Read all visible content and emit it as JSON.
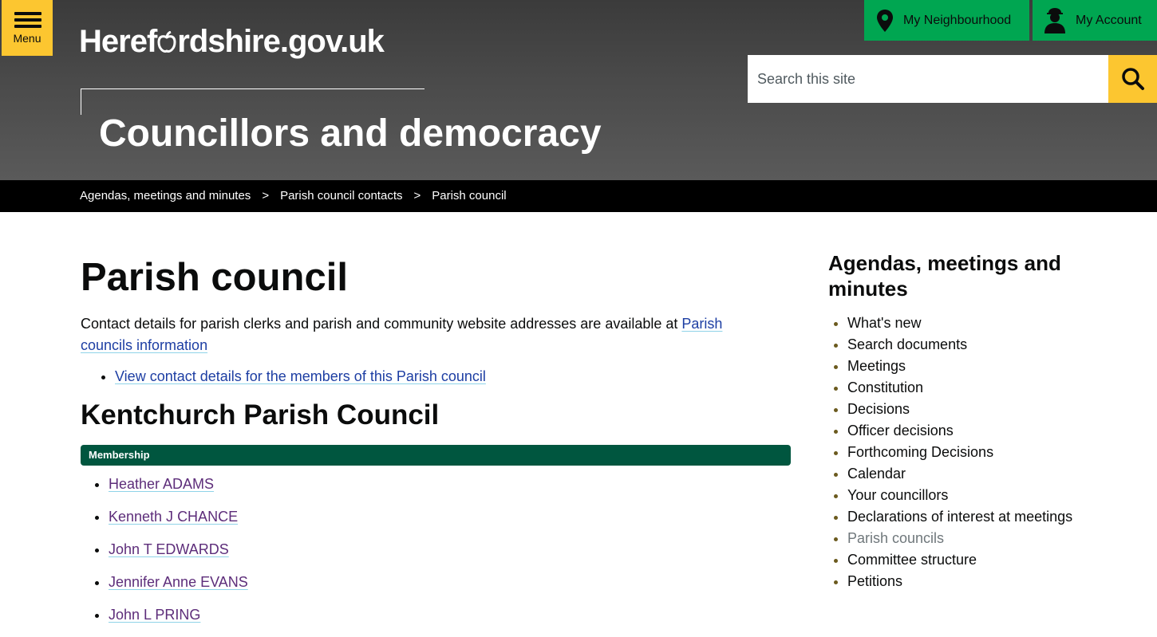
{
  "header": {
    "menu_label": "Menu",
    "logo_pre": "Heref",
    "logo_post": "rdshire.gov.uk",
    "section_title": "Councillors and democracy",
    "neighbourhood_label": "My Neighbourhood",
    "account_label": "My Account",
    "search_placeholder": "Search this site"
  },
  "breadcrumb": {
    "items": [
      "Agendas, meetings and minutes",
      "Parish council contacts",
      "Parish council"
    ],
    "separator": ">"
  },
  "main": {
    "title": "Parish council",
    "intro_text": "Contact details for parish clerks and parish and community website addresses are available at ",
    "intro_link": "Parish councils information",
    "members_link": "View contact details for the members of this Parish council",
    "council_name": "Kentchurch Parish Council",
    "membership_label": "Membership",
    "members": [
      "Heather ADAMS",
      "Kenneth J CHANCE",
      "John T EDWARDS",
      "Jennifer Anne EVANS",
      "John L PRING"
    ]
  },
  "sidebar": {
    "title": "Agendas, meetings and minutes",
    "items": [
      "What's new",
      "Search documents",
      "Meetings",
      "Constitution",
      "Decisions",
      "Officer decisions",
      "Forthcoming Decisions",
      "Calendar",
      "Your councillors",
      "Declarations of interest at meetings",
      "Parish councils",
      "Committee structure",
      "Petitions"
    ],
    "current_item": "Parish councils"
  },
  "colors": {
    "accent_yellow": "#fcc630",
    "button_green": "#00a651",
    "membership_green": "#00563f",
    "link_blue": "#1d3ea3",
    "visited_purple": "#5d2d7a"
  },
  "icons": {
    "menu": "hamburger-icon",
    "neighbourhood": "map-pin-icon",
    "account": "person-icon",
    "search": "magnifier-icon",
    "logo": "apple-icon"
  }
}
